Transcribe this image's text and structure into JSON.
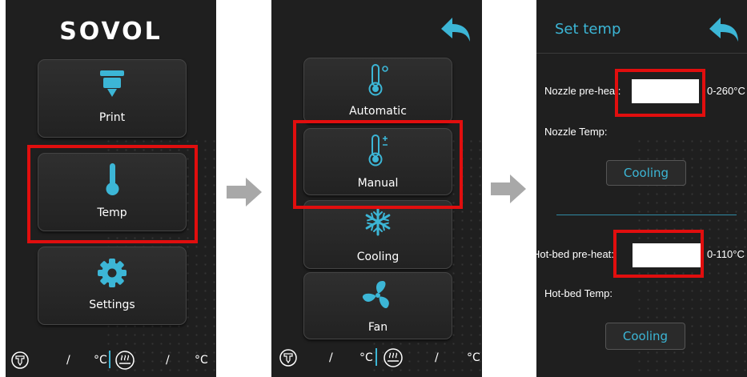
{
  "panel1": {
    "logo": "SOVOL",
    "buttons": [
      {
        "label": "Print",
        "icon": "print-head-icon"
      },
      {
        "label": "Temp",
        "icon": "thermometer-icon"
      },
      {
        "label": "Settings",
        "icon": "gear-icon"
      }
    ],
    "status": {
      "nozzle_sep": "/",
      "nozzle_unit": "°C",
      "bed_sep": "/",
      "bed_unit": "°C"
    }
  },
  "panel2": {
    "buttons": [
      {
        "label": "Automatic",
        "icon": "thermometer-auto-icon"
      },
      {
        "label": "Manual",
        "icon": "thermometer-plus-minus-icon"
      },
      {
        "label": "Cooling",
        "icon": "snowflake-icon"
      },
      {
        "label": "Fan",
        "icon": "fan-icon"
      }
    ],
    "status": {
      "nozzle_sep": "/",
      "nozzle_unit": "°C",
      "bed_sep": "/",
      "bed_unit": "°C"
    }
  },
  "panel3": {
    "title": "Set temp",
    "nozzle_preheat_label": "Nozzle pre-heat:",
    "nozzle_range": "0-260°C",
    "nozzle_temp_label": "Nozzle Temp:",
    "nozzle_cooling": "Cooling",
    "bed_preheat_label": "Hot-bed pre-heat:",
    "bed_range": "0-110°C",
    "bed_temp_label": "Hot-bed Temp:",
    "bed_cooling": "Cooling"
  },
  "colors": {
    "accent": "#3cb6d6",
    "highlight": "#e10e0e",
    "panel": "#1f1f1f"
  }
}
